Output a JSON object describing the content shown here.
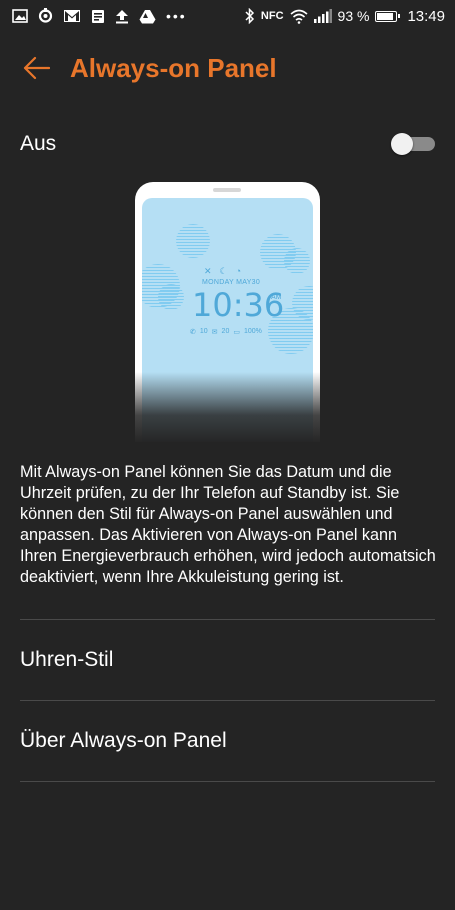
{
  "status_bar": {
    "battery_percent": "93 %",
    "battery_level": 0.93,
    "nfc": "NFC",
    "time": "13:49",
    "overflow": "•••"
  },
  "header": {
    "title": "Always-on Panel"
  },
  "toggle": {
    "label": "Aus",
    "on": false
  },
  "preview": {
    "date": "MONDAY MAY30",
    "time": "10:36",
    "ampm": "AM",
    "stat_calls": "10",
    "stat_messages": "20",
    "stat_battery": "100%"
  },
  "description": "Mit Always-on Panel können Sie das Datum und die Uhrzeit prüfen, zu der Ihr Telefon auf Standby ist. Sie können den Stil für Always-on Panel auswählen und anpassen. Das Aktivieren von Always-on Panel kann Ihren Energieverbrauch erhöhen, wird jedoch automatsich deaktiviert, wenn Ihre Akkuleistung gering ist.",
  "menu": [
    {
      "label": "Uhren-Stil"
    },
    {
      "label": "Über Always-on Panel"
    }
  ],
  "colors": {
    "accent": "#e8762b",
    "background": "#242424",
    "preview_screen": "#b5dff4"
  }
}
